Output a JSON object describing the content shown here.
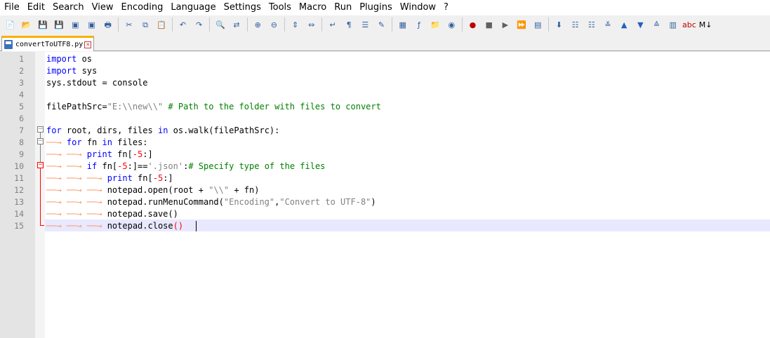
{
  "menu": [
    "File",
    "Edit",
    "Search",
    "View",
    "Encoding",
    "Language",
    "Settings",
    "Tools",
    "Macro",
    "Run",
    "Plugins",
    "Window",
    "?"
  ],
  "toolbar_icons": [
    "new-file-icon",
    "open-file-icon",
    "save-icon",
    "save-all-icon",
    "close-icon",
    "close-all-icon",
    "print-icon",
    "cut-icon",
    "copy-icon",
    "paste-icon",
    "undo-icon",
    "redo-icon",
    "find-icon",
    "replace-icon",
    "zoom-in-icon",
    "zoom-out-icon",
    "sync-vertical-icon",
    "sync-horizontal-icon",
    "word-wrap-icon",
    "show-all-chars-icon",
    "indent-guide-icon",
    "language-icon",
    "doc-map-icon",
    "function-list-icon",
    "folder-workspace-icon",
    "monitor-icon",
    "record-macro-icon",
    "stop-record-icon",
    "play-macro-icon",
    "play-multiple-icon",
    "save-macro-icon",
    "insert-icon",
    "list-icon",
    "list-remove-icon",
    "collapse-icon",
    "up-icon",
    "down-icon",
    "expand-icon",
    "column-icon",
    "spellcheck-icon",
    "markdown-icon"
  ],
  "tab": {
    "label": "convertToUTF8.py"
  },
  "lines": [
    "1",
    "2",
    "3",
    "4",
    "5",
    "6",
    "7",
    "8",
    "9",
    "10",
    "11",
    "12",
    "13",
    "14",
    "15"
  ],
  "code": {
    "l1_kw": "import",
    "l1_rest": " os",
    "l2_kw": "import",
    "l2_rest": " sys",
    "l3": "sys.stdout = console",
    "l5_a": "filePathSrc=",
    "l5_str": "\"E:\\\\new\\\\\"",
    "l5_cmt": " # Path to the folder with files to convert",
    "l7_kw1": "for",
    "l7_a": " root, dirs, files ",
    "l7_kw2": "in",
    "l7_b": " os.walk(filePathSrc):",
    "l8_kw1": "for",
    "l8_a": " fn ",
    "l8_kw2": "in",
    "l8_b": " files:",
    "l9_kw": "print",
    "l9_a": " fn[",
    "l9_num": "-5",
    "l9_b": ":]",
    "l10_kw": "if",
    "l10_a": " fn[",
    "l10_num": "-5",
    "l10_b": ":]==",
    "l10_str": "'.json'",
    "l10_c": ":",
    "l10_cmt": "# Specify type of the files",
    "l11_kw": "print",
    "l11_a": " fn[",
    "l11_num": "-5",
    "l11_b": ":]",
    "l12_a": "notepad.open(root + ",
    "l12_str": "\"\\\\\"",
    "l12_b": " + fn)",
    "l13_a": "notepad.runMenuCommand(",
    "l13_str1": "\"Encoding\"",
    "l13_b": ",",
    "l13_str2": "\"Convert to UTF-8\"",
    "l13_c": ")",
    "l14": "notepad.save()",
    "l15_a": "notepad.close",
    "l15_par": "()"
  },
  "colors": {
    "keyword": "#0000ff",
    "string": "#808080",
    "comment": "#008000",
    "number": "#ff0000",
    "current_line": "#e8e8ff"
  }
}
